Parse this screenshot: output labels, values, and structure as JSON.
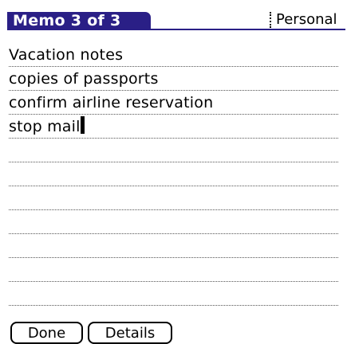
{
  "header": {
    "title": "Memo 3 of 3",
    "category": "Personal"
  },
  "memo": {
    "lines": [
      "Vacation notes",
      "copies of passports",
      "confirm airline reservation",
      "stop mail",
      "",
      "",
      "",
      "",
      "",
      "",
      "",
      ""
    ]
  },
  "buttons": {
    "done": "Done",
    "details": "Details"
  },
  "colors": {
    "title_bar": "#2a1f86",
    "title_text": "#ffffff"
  }
}
